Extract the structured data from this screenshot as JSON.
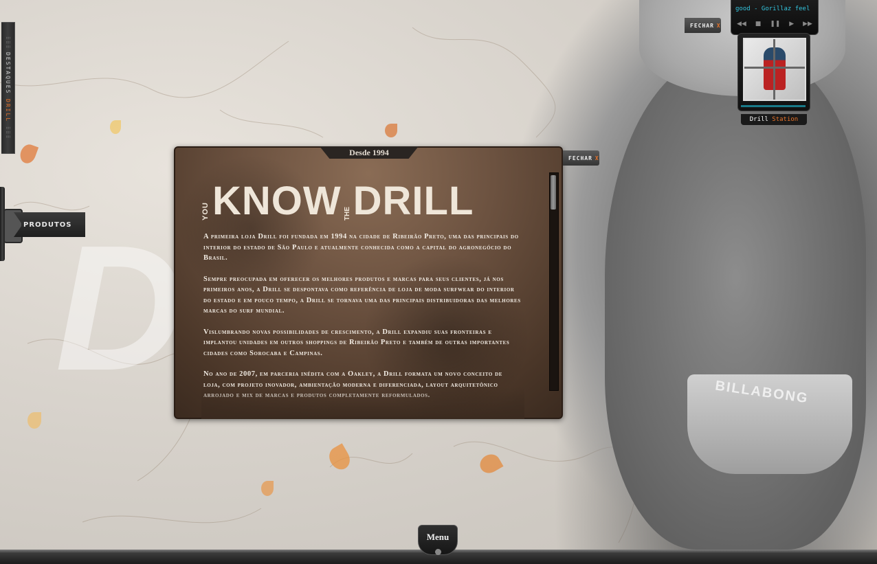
{
  "side_tab": {
    "label": "DESTAQUES",
    "accent_label": "DRILL"
  },
  "produtos": {
    "label": "PRODUTOS"
  },
  "player": {
    "ticker": "good  - Gorillaz feel good",
    "controls": [
      "◀◀",
      "■",
      "❚❚",
      "▶",
      "▶▶"
    ],
    "station_label": "Drill",
    "station_accent": "Station"
  },
  "fechar_top": {
    "label": "FECHAR",
    "x": "X"
  },
  "fechar_panel": {
    "label": "FECHAR",
    "x": "X"
  },
  "panel": {
    "badge": "Desde 1994",
    "headline_you": "YOU",
    "headline_know": "KNOW",
    "headline_the": "THE",
    "headline_drill": "DRILL",
    "paragraphs": [
      "A primeira loja Drill foi fundada em 1994 na cidade de Ribeirão Preto, uma das principais do interior do estado de São Paulo e atualmente conhecida como a capital do agronegócio do Brasil.",
      "Sempre preocupada em oferecer os melhores produtos e marcas para seus clientes, já nos primeiros anos, a Drill se despontava como referência de loja de moda surfwear do interior do estado e em pouco tempo, a Drill se tornava uma das principais distribuidoras das melhores marcas do surf mundial.",
      "Vislumbrando novas possibilidades de crescimento, a Drill expandiu suas fronteiras e implantou unidades em outros shoppings de Ribeirão Preto e também de outras importantes cidades como Sorocaba e Campinas.",
      "No ano de 2007, em parceria inédita com a Oakley, a Drill formata um novo conceito de loja, com projeto inovador, ambientação moderna e diferenciada, layout arquitetônico arrojado e mix de marcas e produtos completamente reformulados."
    ]
  },
  "menu": {
    "label": "Menu"
  },
  "photo": {
    "brand": "BILLABONG"
  },
  "colors": {
    "accent": "#e8732a",
    "ticker": "#34c6e0",
    "panel": "#6c5240"
  }
}
